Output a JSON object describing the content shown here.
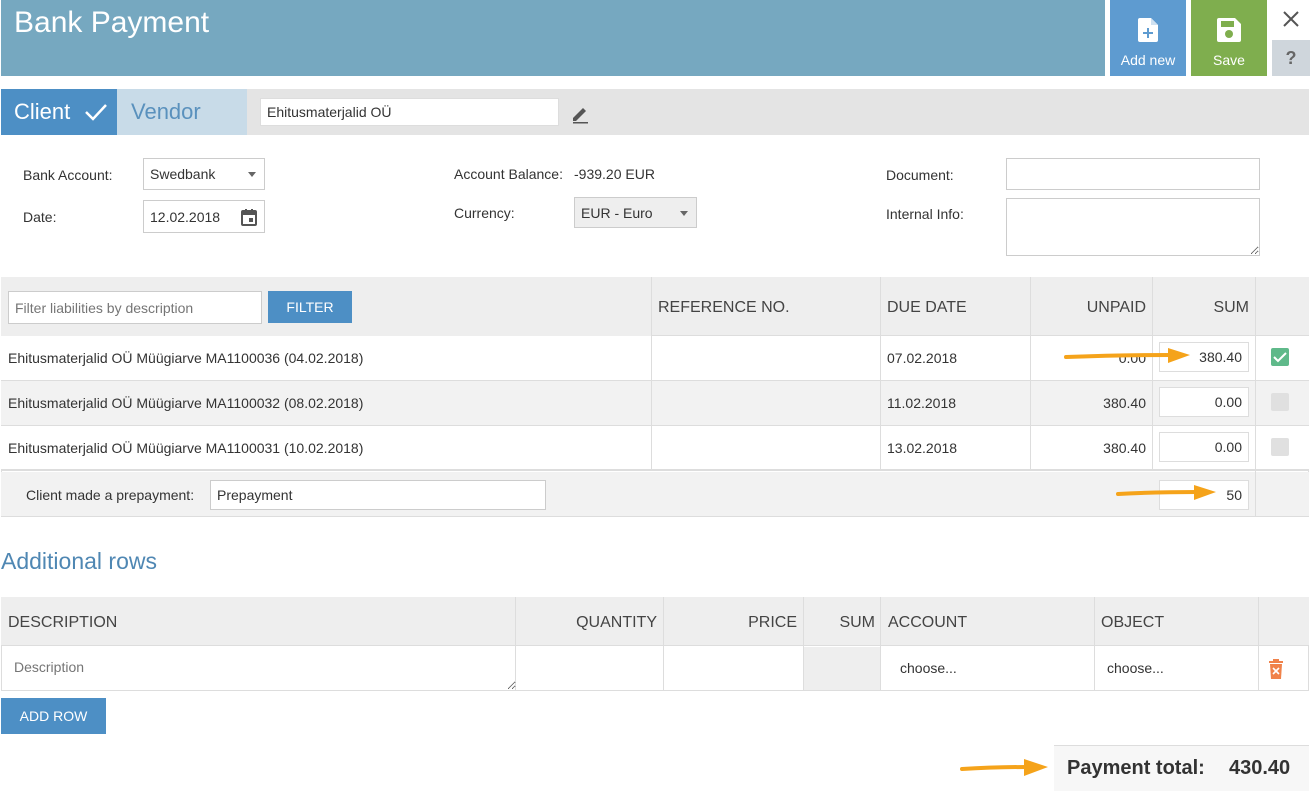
{
  "header": {
    "title": "Bank Payment",
    "add_new_label": "Add new",
    "save_label": "Save",
    "help_label": "?"
  },
  "party": {
    "client_label": "Client",
    "vendor_label": "Vendor",
    "name_value": "Ehitusmaterjalid OÜ"
  },
  "form": {
    "bank_account_label": "Bank Account:",
    "bank_account_value": "Swedbank",
    "date_label": "Date:",
    "date_value": "12.02.2018",
    "account_balance_label": "Account Balance:",
    "account_balance_value": "-939.20 EUR",
    "currency_label": "Currency:",
    "currency_value": "EUR - Euro",
    "document_label": "Document:",
    "document_value": "",
    "internal_info_label": "Internal Info:",
    "internal_info_value": ""
  },
  "liabilities": {
    "filter_placeholder": "Filter liabilities by description",
    "filter_button": "FILTER",
    "columns": [
      "REFERENCE NO.",
      "DUE DATE",
      "UNPAID",
      "SUM"
    ],
    "rows": [
      {
        "description": "Ehitusmaterjalid OÜ Müügiarve MA1100036 (04.02.2018)",
        "reference": "",
        "due_date": "07.02.2018",
        "unpaid": "0.00",
        "sum": "380.40",
        "checked": true
      },
      {
        "description": "Ehitusmaterjalid OÜ Müügiarve MA1100032 (08.02.2018)",
        "reference": "",
        "due_date": "11.02.2018",
        "unpaid": "380.40",
        "sum": "0.00",
        "checked": false
      },
      {
        "description": "Ehitusmaterjalid OÜ Müügiarve MA1100031 (10.02.2018)",
        "reference": "",
        "due_date": "13.02.2018",
        "unpaid": "380.40",
        "sum": "0.00",
        "checked": false
      }
    ],
    "prepayment_label": "Client made a prepayment:",
    "prepayment_value": "Prepayment",
    "prepayment_sum": "50"
  },
  "additional": {
    "title": "Additional rows",
    "columns": [
      "DESCRIPTION",
      "QUANTITY",
      "PRICE",
      "SUM",
      "ACCOUNT",
      "OBJECT"
    ],
    "row": {
      "description_placeholder": "Description",
      "account_value": "choose...",
      "object_value": "choose..."
    },
    "add_row_button": "ADD ROW"
  },
  "total": {
    "label": "Payment total:",
    "value": "430.40"
  },
  "colors": {
    "header_bg": "#76a8c0",
    "primary": "#4d8fc5",
    "save_green": "#7fae4e",
    "check_green": "#5fb98a",
    "arrow_orange": "#f5a31a",
    "delete_orange": "#f0824a"
  }
}
